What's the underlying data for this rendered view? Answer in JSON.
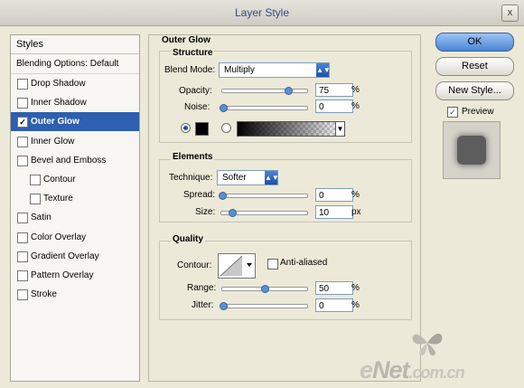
{
  "window": {
    "title": "Layer Style",
    "close_symbol": "x"
  },
  "left_panel": {
    "header": "Styles",
    "blending": "Blending Options: Default",
    "items": [
      {
        "label": "Drop Shadow",
        "checked": false
      },
      {
        "label": "Inner Shadow",
        "checked": false
      },
      {
        "label": "Outer Glow",
        "checked": true,
        "selected": true
      },
      {
        "label": "Inner Glow",
        "checked": false
      },
      {
        "label": "Bevel and Emboss",
        "checked": false
      },
      {
        "label": "Contour",
        "checked": false,
        "indent": true
      },
      {
        "label": "Texture",
        "checked": false,
        "indent": true
      },
      {
        "label": "Satin",
        "checked": false
      },
      {
        "label": "Color Overlay",
        "checked": false
      },
      {
        "label": "Gradient Overlay",
        "checked": false
      },
      {
        "label": "Pattern Overlay",
        "checked": false
      },
      {
        "label": "Stroke",
        "checked": false
      }
    ],
    "check_mark": "✓"
  },
  "outer_glow": {
    "title": "Outer Glow",
    "structure": {
      "title": "Structure",
      "blend_mode_label": "Blend Mode:",
      "blend_mode_value": "Multiply",
      "opacity_label": "Opacity:",
      "opacity_value": "75",
      "noise_label": "Noise:",
      "noise_value": "0",
      "percent": "%",
      "glow_color": "#000000"
    },
    "elements": {
      "title": "Elements",
      "technique_label": "Technique:",
      "technique_value": "Softer",
      "spread_label": "Spread:",
      "spread_value": "0",
      "size_label": "Size:",
      "size_value": "10",
      "px": "px",
      "percent": "%"
    },
    "quality": {
      "title": "Quality",
      "contour_label": "Contour:",
      "anti_aliased_label": "Anti-aliased",
      "range_label": "Range:",
      "range_value": "50",
      "jitter_label": "Jitter:",
      "jitter_value": "0",
      "percent": "%"
    }
  },
  "buttons": {
    "ok": "OK",
    "reset": "Reset",
    "new_style": "New Style...",
    "preview_label": "Preview"
  },
  "watermark": {
    "prefix": "e",
    "brand": "Net",
    "suffix": ".com.cn"
  },
  "colors": {
    "accent": "#2e5fb0",
    "glow": "#000000"
  }
}
